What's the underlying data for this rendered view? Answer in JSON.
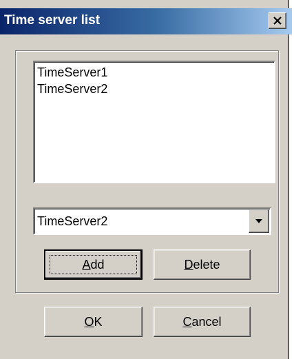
{
  "window": {
    "title": "Time server list",
    "close_icon": "close-icon"
  },
  "server_list": {
    "items": [
      "TimeServer1",
      "TimeServer2"
    ]
  },
  "server_combo": {
    "value": "TimeServer2",
    "arrow_icon": "chevron-down-icon"
  },
  "buttons": {
    "add": {
      "mnemonic": "A",
      "rest": "dd"
    },
    "delete": {
      "mnemonic": "D",
      "rest": "elete"
    },
    "ok": {
      "mnemonic": "O",
      "rest": "K"
    },
    "cancel": {
      "mnemonic": "C",
      "rest": "ancel"
    }
  },
  "colors": {
    "dialog_face": "#d4d0c8",
    "title_gradient_start": "#0a246a",
    "title_gradient_end": "#a6caf0"
  }
}
